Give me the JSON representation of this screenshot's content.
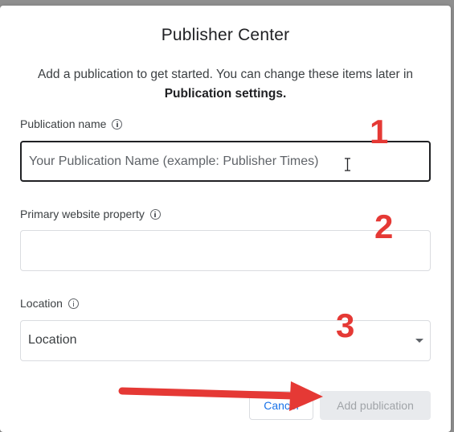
{
  "dialog": {
    "title": "Publisher Center",
    "subtitle_part1": "Add a publication to get started. You can change these items later in ",
    "subtitle_bold": "Publication settings."
  },
  "fields": {
    "publication_name": {
      "label": "Publication name",
      "placeholder": "Your Publication Name (example: Publisher Times)",
      "value": ""
    },
    "website_property": {
      "label": "Primary website property",
      "placeholder": "",
      "value": ""
    },
    "location": {
      "label": "Location",
      "selected": "Location"
    }
  },
  "buttons": {
    "cancel": "Cancel",
    "add": "Add publication"
  },
  "annotations": {
    "step1": "1",
    "step2": "2",
    "step3": "3",
    "color": "#e53935"
  },
  "icons": {
    "info": "info-circle-icon",
    "dropdown": "caret-down-icon",
    "cursor": "text-cursor-icon",
    "arrow": "red-arrow-icon"
  }
}
